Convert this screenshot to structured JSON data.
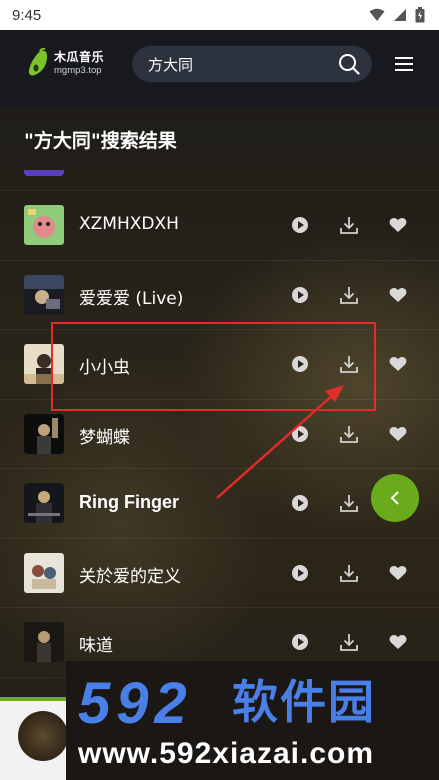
{
  "status_bar": {
    "time": "9:45"
  },
  "header": {
    "logo_name": "木瓜音乐",
    "logo_domain": "mgmp3.top",
    "search_value": "方大同"
  },
  "results_title": "\"方大同\"搜索结果",
  "songs": [
    {
      "title": "XZMHXDXH"
    },
    {
      "title": "爱爱爱 (Live)"
    },
    {
      "title": "小小虫"
    },
    {
      "title": "梦蝴蝶"
    },
    {
      "title": "Ring Finger"
    },
    {
      "title": "关於爱的定义"
    },
    {
      "title": "味道"
    }
  ],
  "watermark": {
    "number": "592",
    "brand": "软件园",
    "url": "www.592xiazai.com"
  },
  "colors": {
    "accent_green": "#6aab1b",
    "highlight_red": "#e52a2a",
    "watermark_blue": "#4a7fe8"
  },
  "icons": [
    "search-icon",
    "menu-icon",
    "play-icon",
    "download-icon",
    "heart-icon",
    "chevron-left-icon"
  ]
}
